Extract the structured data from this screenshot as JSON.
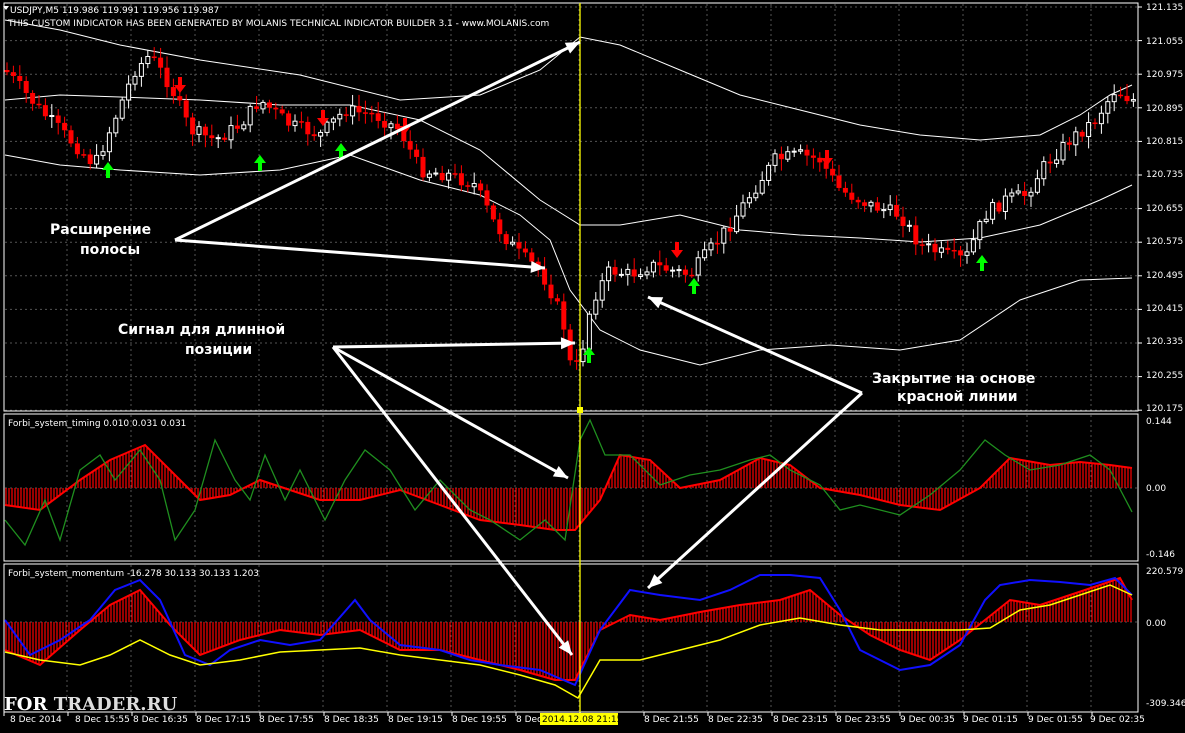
{
  "window": {
    "symbol_line": "USDJPY,M5  119.986 119.991 119.956 119.987",
    "subtitle": "THIS CUSTOM INDICATOR HAS BEEN GENERATED BY MOLANIS TECHNICAL INDICATOR BUILDER 3.1 - www.MOLANIS.com"
  },
  "main_price_axis": [
    "121.135",
    "121.055",
    "120.975",
    "120.895",
    "120.815",
    "120.735",
    "120.655",
    "120.575",
    "120.495",
    "120.415",
    "120.335",
    "120.255",
    "120.175"
  ],
  "timing_panel": {
    "title": "Forbi_system_timing 0.010 0.031 0.031",
    "axis": [
      "0.144",
      "0.00",
      "-0.146"
    ]
  },
  "momentum_panel": {
    "title": "Forbi_system_momentum -16.278 30.133 30.133 1.203",
    "axis": [
      "220.579",
      "0.00",
      "-309.346"
    ]
  },
  "time_axis": [
    "8 Dec 2014",
    "8 Dec 15:55",
    "8 Dec 16:35",
    "8 Dec 17:15",
    "8 Dec 17:55",
    "8 Dec 18:35",
    "8 Dec 19:15",
    "8 Dec 19:55",
    "8 Dec 20:35",
    "2014.12.08 21:15",
    "8 Dec 21:55",
    "8 Dec 22:35",
    "8 Dec 23:15",
    "8 Dec 23:55",
    "9 Dec 00:35",
    "9 Dec 01:15",
    "9 Dec 01:55",
    "9 Dec 02:35"
  ],
  "annotations": {
    "band_widening": [
      "Расширение",
      "полосы"
    ],
    "long_signal": [
      "Сигнал для длинной",
      "позиции"
    ],
    "close_red": [
      "Закрытие на основе",
      "красной линии"
    ]
  },
  "watermark": {
    "part1": "FOR",
    "part2": "TRADER.RU"
  },
  "colors": {
    "bull": "#ffffff",
    "bear": "#ff0000",
    "up_arrow": "#00ff00",
    "down_arrow": "#ff0000",
    "cursor": "#ffff00",
    "band": "#ffffff",
    "timing_line": "#1f8f1f",
    "momentum_blue": "#1010ff",
    "momentum_yellow": "#ffff00",
    "histogram": "#ff0000"
  }
}
